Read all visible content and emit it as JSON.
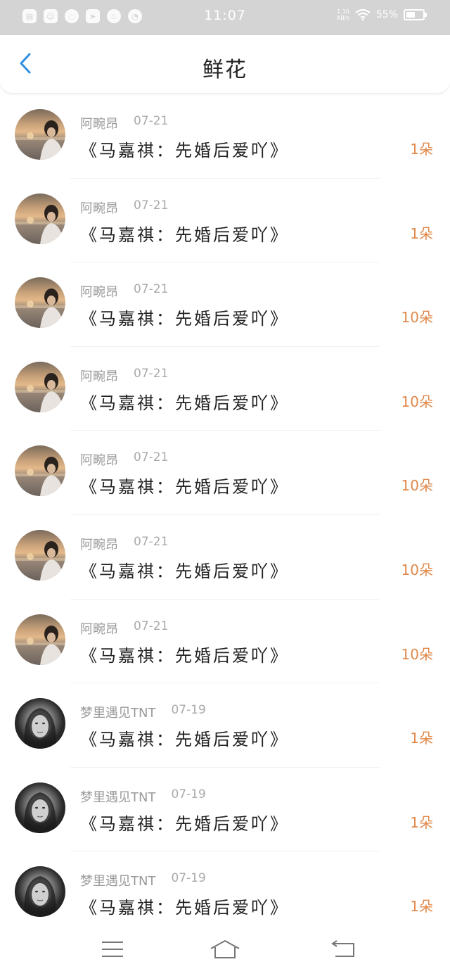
{
  "status_bar": {
    "time": "11:07",
    "network_speed_line1": "1.10",
    "network_speed_line2": "KB/s",
    "battery_percent": "55%",
    "notification_icons": [
      "file-icon",
      "app-icon",
      "chat-icon",
      "send-icon",
      "flame-icon",
      "gauge-icon"
    ]
  },
  "header": {
    "title": "鲜花",
    "back_icon": "chevron-left-icon",
    "accent_color": "#2f8fe0"
  },
  "list": {
    "items": [
      {
        "user": "阿畹昂",
        "date": "07-21",
        "title": "《马嘉祺：先婚后爱吖》",
        "qty": "1朵",
        "avatar": "sunset"
      },
      {
        "user": "阿畹昂",
        "date": "07-21",
        "title": "《马嘉祺：先婚后爱吖》",
        "qty": "1朵",
        "avatar": "sunset"
      },
      {
        "user": "阿畹昂",
        "date": "07-21",
        "title": "《马嘉祺：先婚后爱吖》",
        "qty": "10朵",
        "avatar": "sunset"
      },
      {
        "user": "阿畹昂",
        "date": "07-21",
        "title": "《马嘉祺：先婚后爱吖》",
        "qty": "10朵",
        "avatar": "sunset"
      },
      {
        "user": "阿畹昂",
        "date": "07-21",
        "title": "《马嘉祺：先婚后爱吖》",
        "qty": "10朵",
        "avatar": "sunset"
      },
      {
        "user": "阿畹昂",
        "date": "07-21",
        "title": "《马嘉祺：先婚后爱吖》",
        "qty": "10朵",
        "avatar": "sunset"
      },
      {
        "user": "阿畹昂",
        "date": "07-21",
        "title": "《马嘉祺：先婚后爱吖》",
        "qty": "10朵",
        "avatar": "sunset"
      },
      {
        "user": "梦里遇见TNT",
        "date": "07-19",
        "title": "《马嘉祺：先婚后爱吖》",
        "qty": "1朵",
        "avatar": "dark"
      },
      {
        "user": "梦里遇见TNT",
        "date": "07-19",
        "title": "《马嘉祺：先婚后爱吖》",
        "qty": "1朵",
        "avatar": "dark"
      },
      {
        "user": "梦里遇见TNT",
        "date": "07-19",
        "title": "《马嘉祺：先婚后爱吖》",
        "qty": "1朵",
        "avatar": "dark"
      }
    ]
  },
  "nav_bar": {
    "menu_icon": "menu-icon",
    "home_icon": "home-icon",
    "back_icon": "back-icon"
  },
  "colors": {
    "quantity": "#e0894a",
    "status_bar_bg": "#d4d4d4"
  }
}
